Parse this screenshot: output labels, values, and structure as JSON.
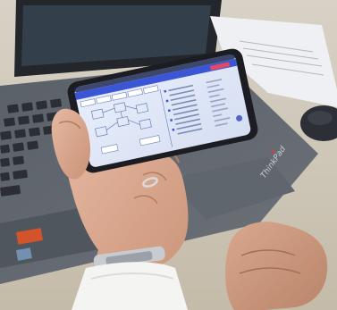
{
  "scene": {
    "subject": "hand-holding-smartphone",
    "background_object": "laptop-keyboard",
    "laptop_brand": "ThinkPad"
  },
  "phone_screen": {
    "status_left": "",
    "status_right": "",
    "header_text": "",
    "tabs": [
      "",
      "",
      "",
      "",
      ""
    ],
    "list_labels": [
      "",
      "",
      "",
      "",
      "",
      "",
      "",
      "",
      "",
      ""
    ],
    "colors": {
      "screen_bg": "#dfe8f8",
      "header_bar": "#3a56d6",
      "accent_red": "#e04a62",
      "panel_line": "#6b7fb8"
    }
  }
}
